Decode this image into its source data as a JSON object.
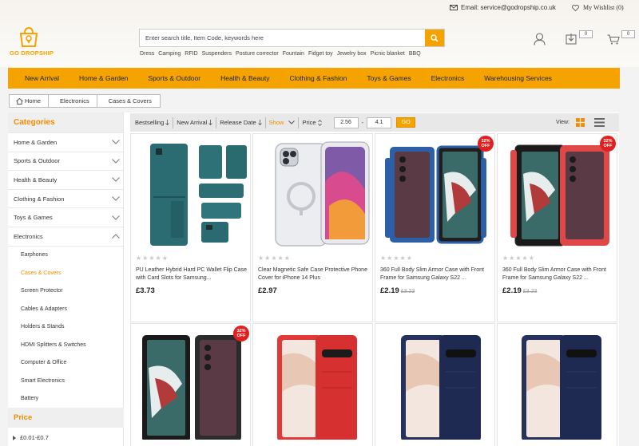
{
  "topbar": {
    "email": "Email: service@godropship.co.uk",
    "wishlist": "My Wishlist (0)"
  },
  "logo": {
    "text": "GO DROPSHIP"
  },
  "search": {
    "placeholder": "Enter search title, Item Code, keywords here"
  },
  "hotwords": [
    "Dress",
    "Camping",
    "RFID",
    "Suspenders",
    "Posture corrector",
    "Fountain",
    "Fidget toy",
    "Jewelry box",
    "Picnic blanket",
    "BBQ"
  ],
  "header_counts": {
    "compare": "0",
    "cart": "0"
  },
  "nav": [
    "New Arrival",
    "Home & Garden",
    "Sports & Outdoor",
    "Health & Beauty",
    "Clothing & Fashion",
    "Toys & Games",
    "Electronics",
    "Warehousing Services"
  ],
  "breadcrumb": [
    "Home",
    "Electronics",
    "Cases & Covers"
  ],
  "sidebar": {
    "title": "Categories",
    "categories": [
      "Home & Garden",
      "Sports & Outdoor",
      "Health & Beauty",
      "Clothing & Fashion",
      "Toys & Games",
      "Electronics"
    ],
    "subcategories": [
      "Earphones",
      "Cases & Covers",
      "Screen Protector",
      "Cables & Adapters",
      "Holders & Stands",
      "HDMI Splitters & Switches",
      "Computer & Office",
      "Smart Electronics",
      "Battery"
    ],
    "price_title": "Price",
    "price_range": "£0.01-£0.7"
  },
  "toolbar": {
    "bestselling": "Bestselling",
    "new_arrival": "New Arrival",
    "release_date": "Release Date",
    "show": "Show",
    "price": "Price",
    "min": "2.56",
    "max": "4.1",
    "go": "GO",
    "view": "View:"
  },
  "products": [
    {
      "title": "PU Leather Hybrid Hard PC Wallet Flip Case with Card Slots for Samsung...",
      "price": "£3.73",
      "old": "",
      "badge": ""
    },
    {
      "title": "Clear Magnetic Safe Case Protective Phone Cover for iPhone 14 Plus",
      "price": "£2.97",
      "old": "",
      "badge": ""
    },
    {
      "title": "360 Full Body Slim Armor Case with Front Frame for Samsung Galaxy S22 ...",
      "price": "£2.19",
      "old": "£3.23",
      "badge": "32% OFF"
    },
    {
      "title": "360 Full Body Slim Armor Case with Front Frame for Samsung Galaxy S22 ...",
      "price": "£2.19",
      "old": "£3.23",
      "badge": "32% OFF"
    },
    {
      "title": "",
      "price": "",
      "old": "",
      "badge": "32% OFF"
    },
    {
      "title": "",
      "price": "",
      "old": "",
      "badge": ""
    },
    {
      "title": "",
      "price": "",
      "old": "",
      "badge": ""
    },
    {
      "title": "",
      "price": "",
      "old": "",
      "badge": ""
    }
  ],
  "colors": {
    "accent": "#f5a300",
    "category_text": "#f28c00",
    "badge": "#e0201e"
  }
}
